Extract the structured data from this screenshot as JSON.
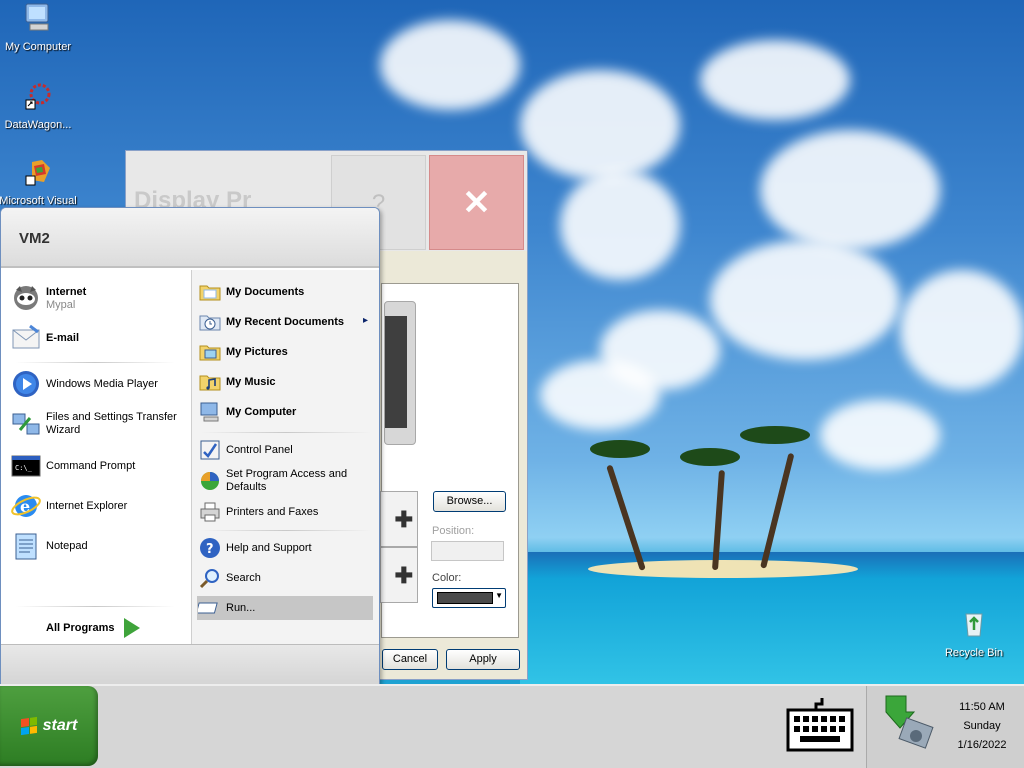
{
  "desktop": {
    "icons": [
      {
        "label": "My Computer"
      },
      {
        "label": "DataWagon..."
      },
      {
        "label": "Microsoft Visual"
      },
      {
        "label": "Recycle Bin"
      }
    ]
  },
  "display_properties": {
    "title": "Display Pr",
    "help_label": "?",
    "close_label": "✕",
    "browse_label": "Browse...",
    "position_label": "Position:",
    "color_label": "Color:",
    "cancel_label": "Cancel",
    "apply_label": "Apply"
  },
  "start_menu": {
    "user": "VM2",
    "pinned": [
      {
        "label": "Internet",
        "sub": "Mypal"
      },
      {
        "label": "E-mail",
        "sub": ""
      }
    ],
    "recent": [
      {
        "label": "Windows Media Player"
      },
      {
        "label": "Files and Settings Transfer Wizard"
      },
      {
        "label": "Command Prompt"
      },
      {
        "label": "Internet Explorer"
      },
      {
        "label": "Notepad"
      }
    ],
    "all_programs_label": "All Programs",
    "places": [
      {
        "label": "My Documents"
      },
      {
        "label": "My Recent Documents"
      },
      {
        "label": "My Pictures"
      },
      {
        "label": "My Music"
      },
      {
        "label": "My Computer"
      }
    ],
    "settings": [
      {
        "label": "Control Panel"
      },
      {
        "label": "Set Program Access and Defaults"
      },
      {
        "label": "Printers and Faxes"
      }
    ],
    "tools": [
      {
        "label": "Help and Support"
      },
      {
        "label": "Search"
      },
      {
        "label": "Run..."
      }
    ],
    "submenu_arrow": "▸"
  },
  "taskbar": {
    "start_label": "start",
    "time": "11:50 AM",
    "day": "Sunday",
    "date": "1/16/2022"
  },
  "colors": {
    "start_green": "#3a8e2f",
    "menu_link": "#0a246a",
    "close_red": "#e7aaaa"
  }
}
